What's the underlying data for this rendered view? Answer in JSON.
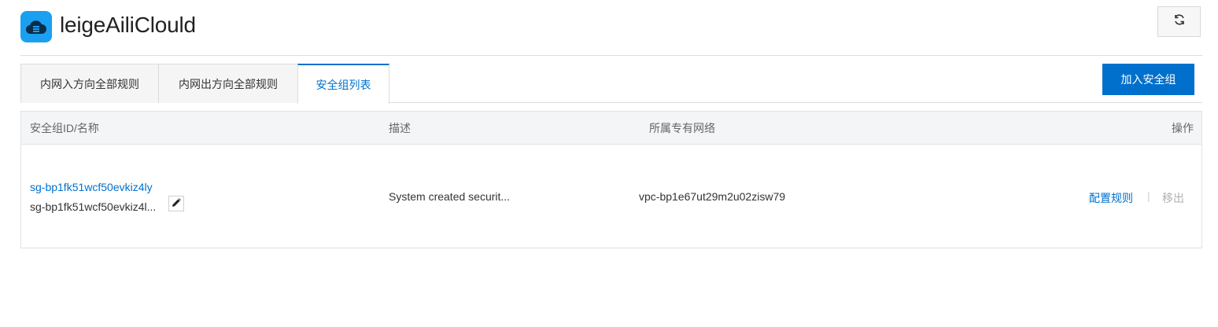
{
  "header": {
    "logo_icon": "cloud-server-icon",
    "title": "leigeAiliClould",
    "refresh_icon": "refresh-icon"
  },
  "tabs": [
    {
      "label": "内网入方向全部规则",
      "active": false
    },
    {
      "label": "内网出方向全部规则",
      "active": false
    },
    {
      "label": "安全组列表",
      "active": true
    }
  ],
  "toolbar": {
    "add_button_label": "加入安全组"
  },
  "table": {
    "columns": [
      "安全组ID/名称",
      "描述",
      "所属专有网络",
      "操作"
    ],
    "rows": [
      {
        "id": "sg-bp1fk51wcf50evkiz4ly",
        "name": "sg-bp1fk51wcf50evkiz4l...",
        "description": "System created securit...",
        "vpc": "vpc-bp1e67ut29m2u02zisw79",
        "action_configure": "配置规则",
        "action_separator": "|",
        "action_remove": "移出"
      }
    ]
  },
  "colors": {
    "accent": "#0070cc",
    "logo_bg": "#1aa0f0"
  }
}
